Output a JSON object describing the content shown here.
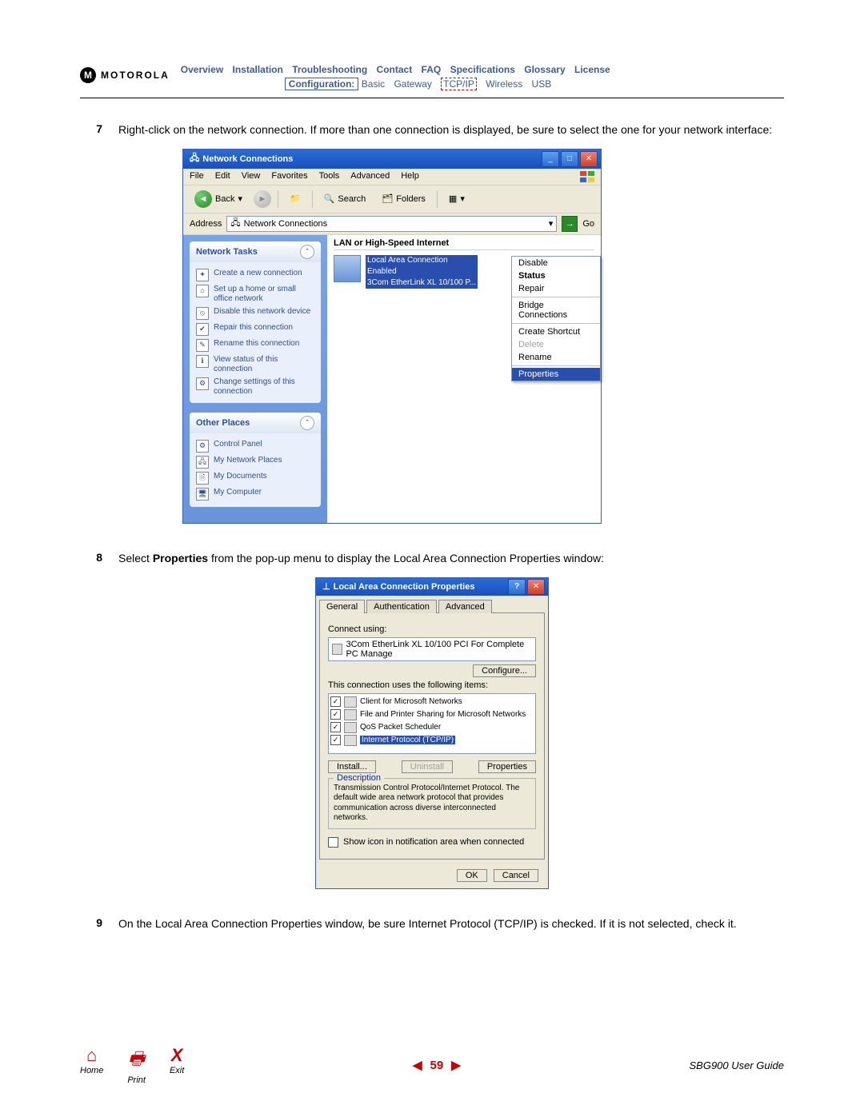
{
  "brand": "MOTOROLA",
  "nav": {
    "row1": [
      "Overview",
      "Installation",
      "Troubleshooting",
      "Contact",
      "FAQ",
      "Specifications",
      "Glossary",
      "License"
    ],
    "row2_label": "Configuration:",
    "row2": [
      "Basic",
      "Gateway",
      "TCP/IP",
      "Wireless",
      "USB"
    ],
    "active_index": 2
  },
  "steps": {
    "s7": {
      "num": "7",
      "text_a": "Right-click on the network connection. If more than one connection is displayed, be sure to select the one for your network interface:"
    },
    "s8": {
      "num": "8",
      "text_a": "Select ",
      "text_b": "Properties",
      "text_c": " from the pop-up menu to display the Local Area Connection Properties window:"
    },
    "s9": {
      "num": "9",
      "text_a": "On the Local Area Connection Properties window, be sure Internet Protocol (TCP/IP) is checked. If it is not selected, check it."
    }
  },
  "win1": {
    "title": "Network Connections",
    "menubar": [
      "File",
      "Edit",
      "View",
      "Favorites",
      "Tools",
      "Advanced",
      "Help"
    ],
    "toolbar": {
      "back": "Back",
      "search": "Search",
      "folders": "Folders"
    },
    "address_label": "Address",
    "address_value": "Network Connections",
    "go": "Go",
    "tasks_header": "Network Tasks",
    "tasks": [
      "Create a new connection",
      "Set up a home or small office network",
      "Disable this network device",
      "Repair this connection",
      "Rename this connection",
      "View status of this connection",
      "Change settings of this connection"
    ],
    "places_header": "Other Places",
    "places": [
      "Control Panel",
      "My Network Places",
      "My Documents",
      "My Computer"
    ],
    "group": "LAN or High-Speed Internet",
    "conn_name": "Local Area Connection",
    "conn_status": "Enabled",
    "conn_adapter": "3Com EtherLink XL 10/100 P...",
    "ctx": [
      "Disable",
      "Status",
      "Repair",
      "Bridge Connections",
      "Create Shortcut",
      "Delete",
      "Rename",
      "Properties"
    ]
  },
  "dlg": {
    "title": "Local Area Connection Properties",
    "tabs": [
      "General",
      "Authentication",
      "Advanced"
    ],
    "connect_using": "Connect using:",
    "adapter": "3Com EtherLink XL 10/100 PCI For Complete PC Manage",
    "configure": "Configure...",
    "uses_label": "This connection uses the following items:",
    "items": [
      "Client for Microsoft Networks",
      "File and Printer Sharing for Microsoft Networks",
      "QoS Packet Scheduler",
      "Internet Protocol (TCP/IP)"
    ],
    "install": "Install...",
    "uninstall": "Uninstall",
    "properties": "Properties",
    "desc_label": "Description",
    "desc_text": "Transmission Control Protocol/Internet Protocol. The default wide area network protocol that provides communication across diverse interconnected networks.",
    "show_icon": "Show icon in notification area when connected",
    "ok": "OK",
    "cancel": "Cancel"
  },
  "footer": {
    "home": "Home",
    "print": "Print",
    "exit": "Exit",
    "page": "59",
    "guide": "SBG900 User Guide"
  }
}
